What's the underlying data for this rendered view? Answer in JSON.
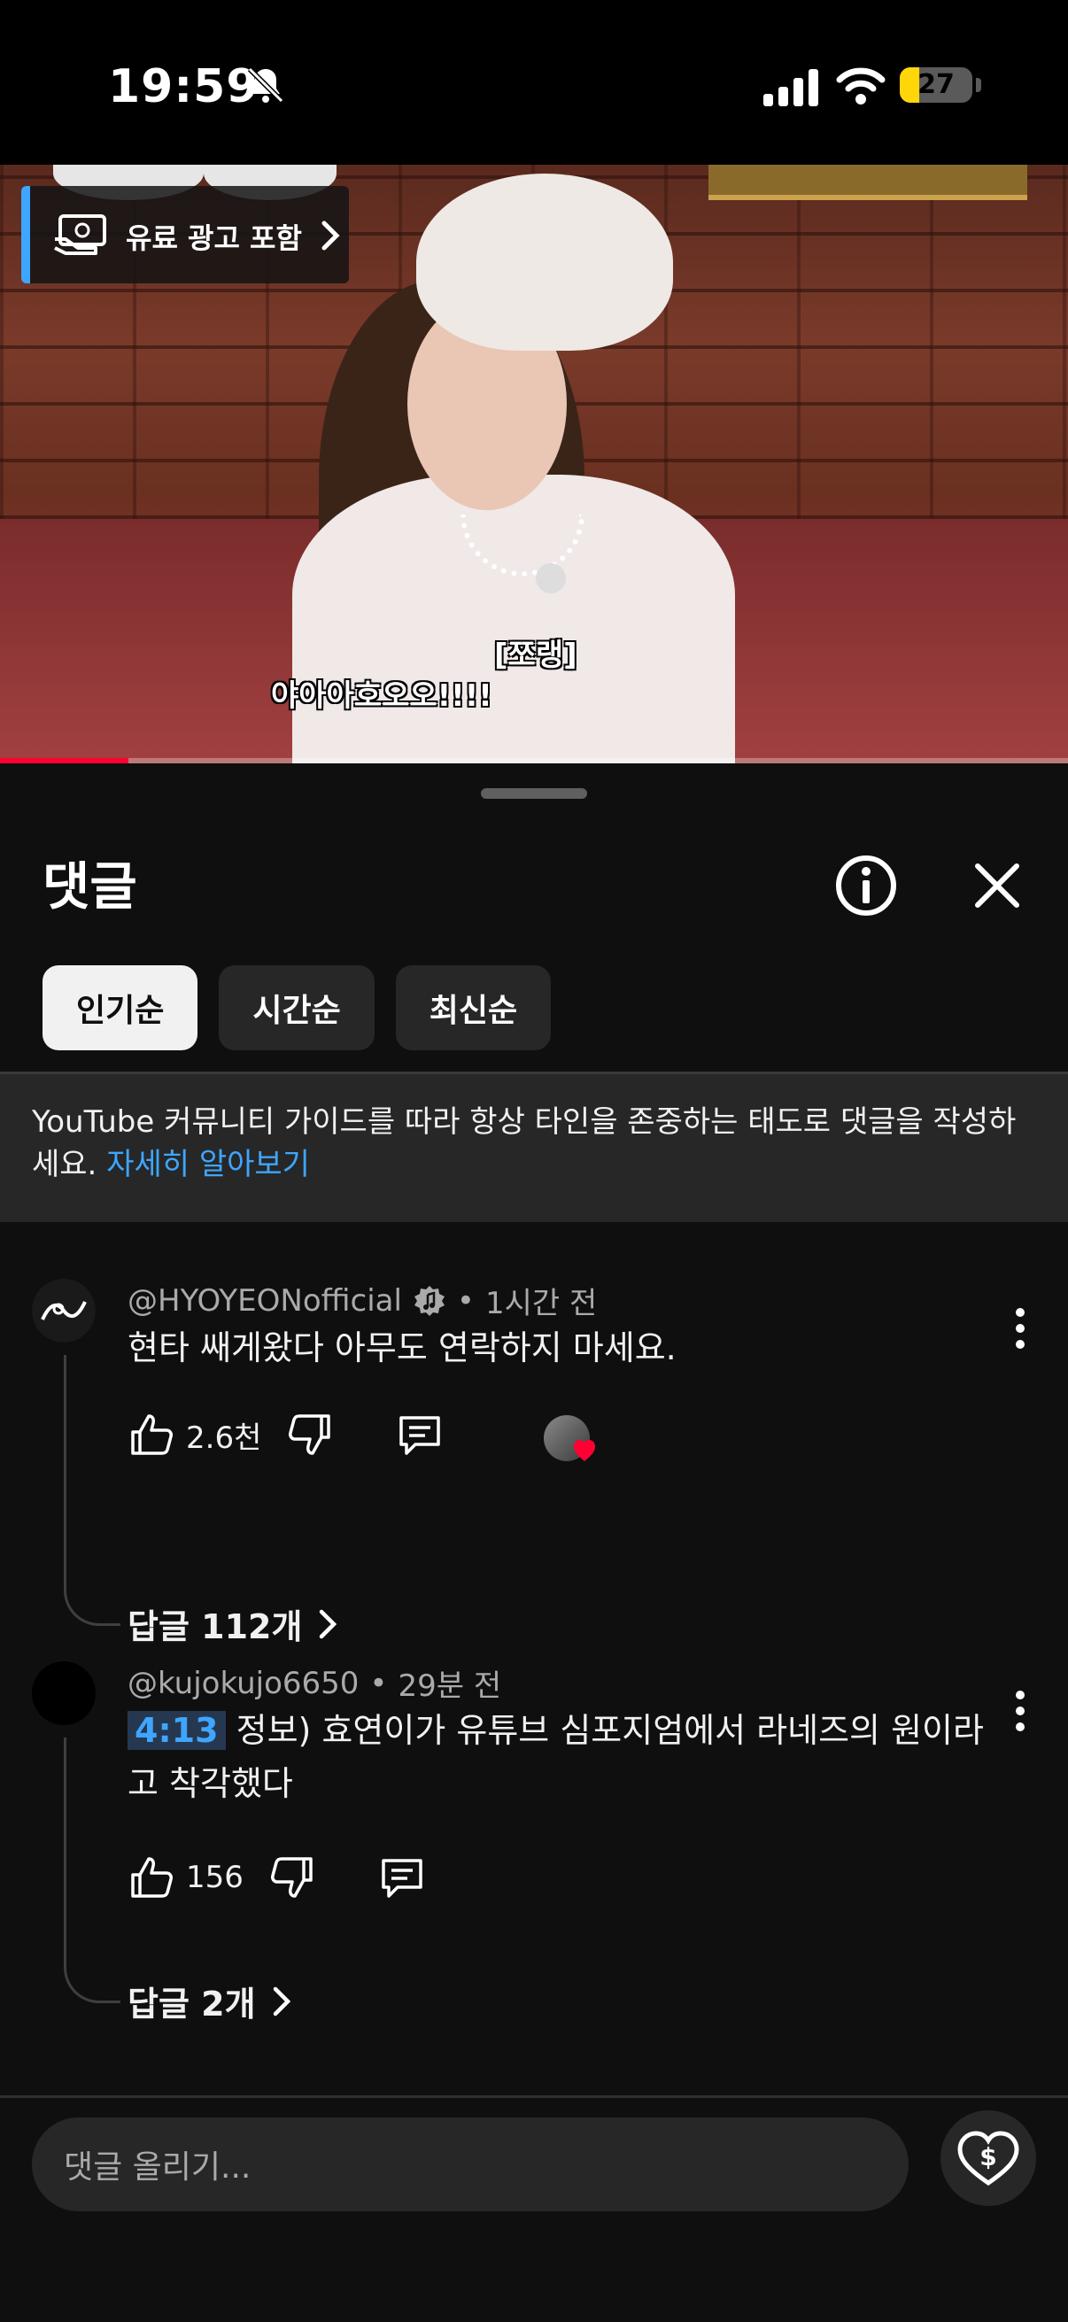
{
  "status_bar": {
    "time": "19:59",
    "battery": "27",
    "battery_level": 0.27
  },
  "video": {
    "paid_promotion": "유료 광고 포함",
    "subtitle_line1": "[쪼랭]",
    "subtitle_line2": "야아아호오오!!!!",
    "progress": 0.12
  },
  "sheet": {
    "title": "댓글",
    "sort_chips": [
      "인기순",
      "시간순",
      "최신순"
    ],
    "guideline_text": "YouTube 커뮤니티 가이드를 따라 항상 타인을 존중하는 태도로 댓글을 작성하세요.",
    "guideline_link": "자세히 알아보기"
  },
  "comments": [
    {
      "author": "@HYOYEONofficial",
      "verified_badge": "music-note-badge-icon",
      "separator": "•",
      "time": "1시간 전",
      "text": "현타 쌔게왔다 아무도 연락하지 마세요.",
      "likes": "2.6천",
      "replies_label": "답글 112개"
    },
    {
      "author": "@kujokujo6650",
      "separator": "•",
      "time": "29분 전",
      "timestamp_link": "4:13",
      "text": " 정보) 효연이가 유튜브 심포지엄에서 라네즈의 원이라고 착각했다",
      "likes": "156",
      "replies_label": "답글 2개"
    }
  ],
  "composer": {
    "placeholder": "댓글 올리기..."
  },
  "colors": {
    "accent_blue": "#3ea6ff",
    "background": "#0f0f0f",
    "chip_bg": "#272727",
    "battery_yellow": "#ffd60a",
    "heart_red": "#ff0033"
  }
}
